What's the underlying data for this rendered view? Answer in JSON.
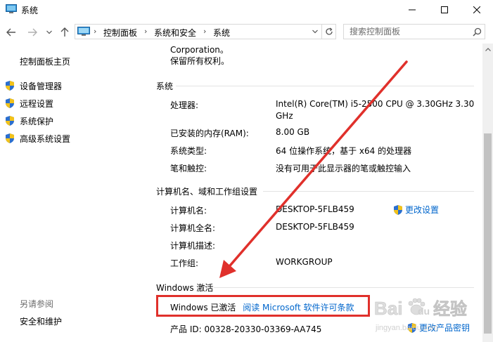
{
  "window": {
    "title": "系统"
  },
  "address_bar": {
    "crumbs": [
      "控制面板",
      "系统和安全",
      "系统"
    ]
  },
  "search": {
    "placeholder": "搜索控制面板"
  },
  "left_pane": {
    "home": "控制面板主页",
    "items": [
      {
        "label": "设备管理器",
        "icon": "shield-icon"
      },
      {
        "label": "远程设置",
        "icon": "shield-icon"
      },
      {
        "label": "系统保护",
        "icon": "shield-icon"
      },
      {
        "label": "高级系统设置",
        "icon": "shield-icon"
      }
    ],
    "see_also": "另请参阅",
    "see_also_items": [
      "安全和维护"
    ]
  },
  "main": {
    "copyright_line1": "Corporation。",
    "copyright_line2": "保留所有权利。",
    "system_section": {
      "title": "系统",
      "rows": [
        {
          "key": "处理器:",
          "value": "Intel(R) Core(TM) i5-2500 CPU @ 3.30GHz   3.30",
          "value2": "GHz"
        },
        {
          "key": "已安装的内存(RAM):",
          "value": "8.00 GB"
        },
        {
          "key": "系统类型:",
          "value": "64 位操作系统，基于 x64 的处理器"
        },
        {
          "key": "笔和触控:",
          "value": "没有可用于此显示器的笔或触控输入"
        }
      ]
    },
    "computer_section": {
      "title": "计算机名、域和工作组设置",
      "rows": [
        {
          "key": "计算机名:",
          "value": "DESKTOP-5FLB459"
        },
        {
          "key": "计算机全名:",
          "value": "DESKTOP-5FLB459"
        },
        {
          "key": "计算机描述:",
          "value": ""
        },
        {
          "key": "工作组:",
          "value": "WORKGROUP"
        }
      ],
      "change_settings": "更改设置"
    },
    "activation_section": {
      "title": "Windows 激活",
      "status": "Windows 已激活",
      "license_link": "阅读 Microsoft 软件许可条款",
      "product_id": "产品 ID: 00328-20330-03369-AA745",
      "change_key": "更改产品密钥"
    }
  },
  "watermark": {
    "text1": "Bai",
    "text2": "du",
    "text3": "经验",
    "text4": "jingyan.baidu.com"
  },
  "colors": {
    "link": "#0066cc",
    "highlight_box": "#e0302b",
    "arrow": "#e0302b"
  }
}
